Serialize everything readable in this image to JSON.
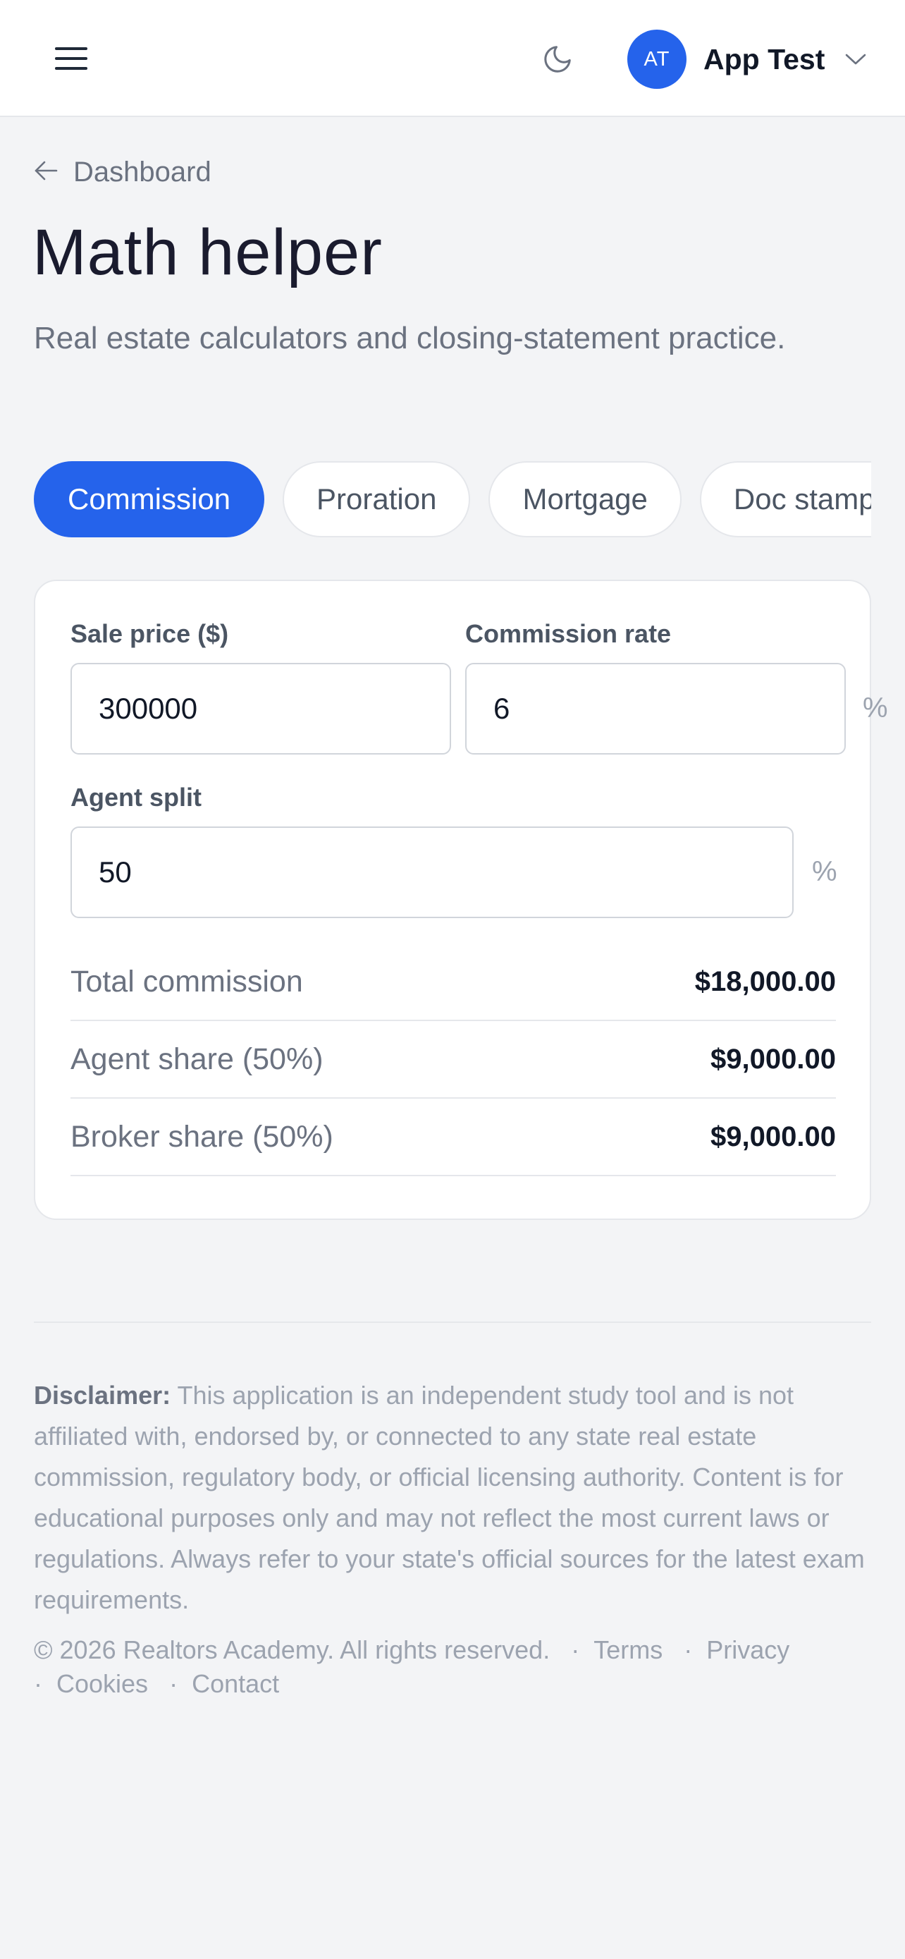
{
  "header": {
    "menu_icon": "hamburger-menu-icon",
    "theme_icon": "moon-icon",
    "user": {
      "initials": "AT",
      "name": "App Test",
      "avatar_color": "#2563eb"
    }
  },
  "breadcrumb": {
    "label": "Dashboard",
    "icon": "arrow-left-icon"
  },
  "page": {
    "title": "Math helper",
    "subtitle": "Real estate calculators and closing-statement practice."
  },
  "tabs": [
    {
      "label": "Commission",
      "active": true
    },
    {
      "label": "Proration",
      "active": false
    },
    {
      "label": "Mortgage",
      "active": false
    },
    {
      "label": "Doc stamps",
      "active": false
    }
  ],
  "calculator": {
    "sale_price": {
      "label": "Sale price ($)",
      "value": "300000"
    },
    "commission_rate": {
      "label": "Commission rate",
      "value": "6",
      "suffix": "%"
    },
    "agent_split": {
      "label": "Agent split",
      "value": "50",
      "suffix": "%"
    },
    "results": [
      {
        "label": "Total commission",
        "value": "$18,000.00"
      },
      {
        "label": "Agent share (50%)",
        "value": "$9,000.00"
      },
      {
        "label": "Broker share (50%)",
        "value": "$9,000.00"
      }
    ]
  },
  "footer": {
    "disclaimer_label": "Disclaimer:",
    "disclaimer_text": "This application is an independent study tool and is not affiliated with, endorsed by, or connected to any state real estate commission, regulatory body, or official licensing authority. Content is for educational purposes only and may not reflect the most current laws or regulations. Always refer to your state's official sources for the latest exam requirements.",
    "copyright": "© 2026 Realtors Academy. All rights reserved.",
    "links": [
      "Terms",
      "Privacy",
      "Cookies",
      "Contact"
    ]
  },
  "colors": {
    "accent": "#2563eb",
    "background": "#f3f4f6",
    "border": "#e5e7eb"
  }
}
